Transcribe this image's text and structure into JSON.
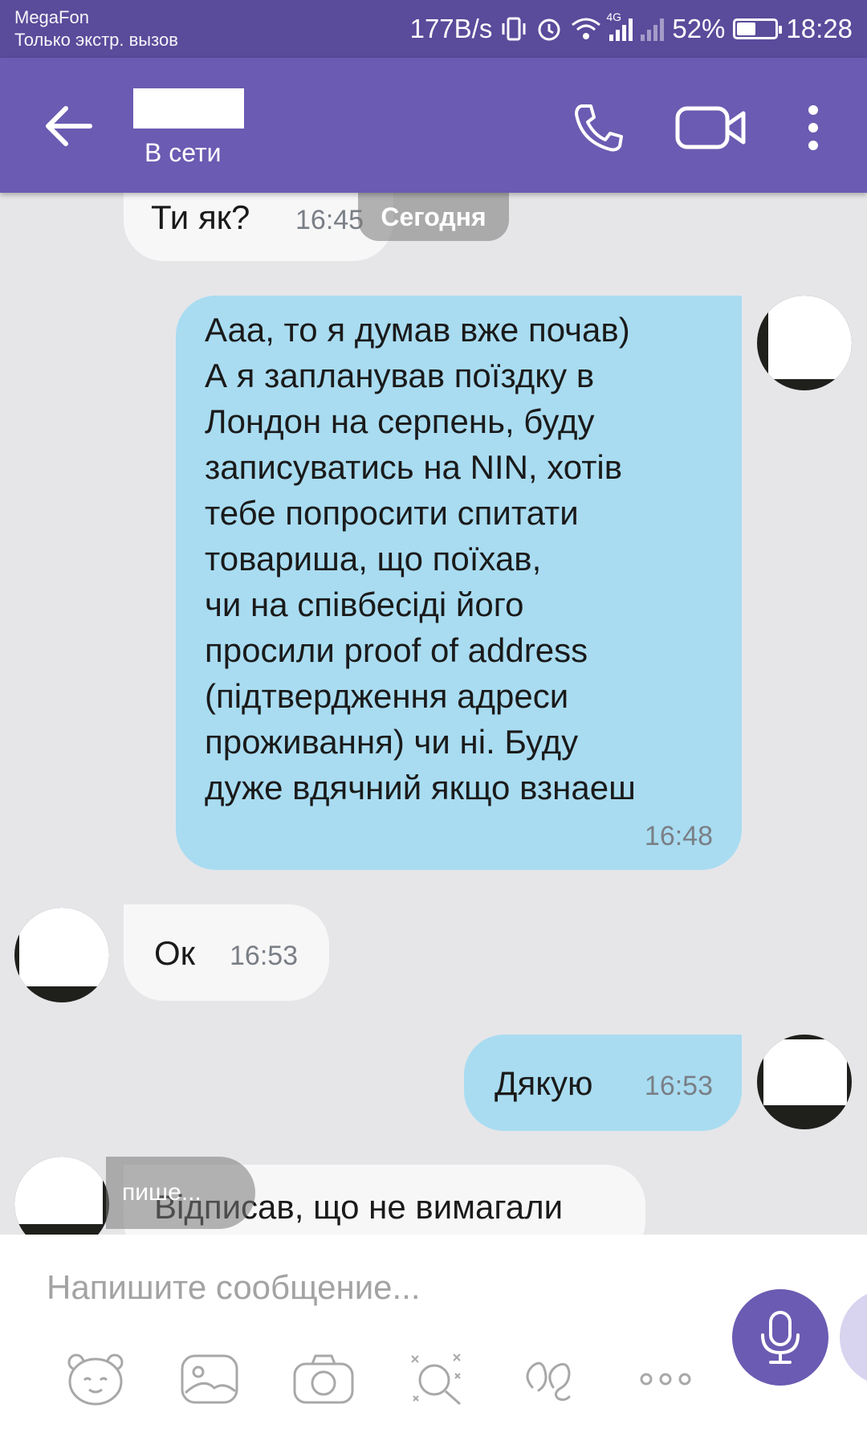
{
  "status_bar": {
    "carrier": "MegaFon",
    "carrier_note": "Только экстр. вызов",
    "net_speed": "177B/s",
    "network_type": "4G",
    "battery": "52%",
    "battery_level": 0.52,
    "time": "18:28"
  },
  "header": {
    "presence": "В сети",
    "icons": [
      "back-arrow-icon",
      "phone-icon",
      "video-camera-icon",
      "more-vertical-icon"
    ]
  },
  "chat": {
    "date_separator": "Сегодня",
    "messages": [
      {
        "direction": "in",
        "text": "Ти як?",
        "time": "16:45"
      },
      {
        "direction": "out",
        "lines": [
          "Ааа, то я думав вже почав)",
          "А я запланував поїздку в",
          "Лондон на серпень, буду",
          "записуватись на NIN, хотів",
          "тебе попросити спитати",
          "товариша, що поїхав,",
          "чи на співбесіді його",
          "просили proof of address",
          "(підтвердження адреси",
          "проживання) чи ні. Буду",
          "дуже вдячний якщо взнаеш"
        ],
        "time": "16:48"
      },
      {
        "direction": "in",
        "text": "Ок",
        "time": "16:53"
      },
      {
        "direction": "out",
        "text": "Дякую",
        "time": "16:53"
      },
      {
        "direction": "in",
        "text": "Відписав, що не вимагали",
        "time": ""
      }
    ],
    "typing_indicator": "пише..."
  },
  "composer": {
    "placeholder": "Напишите сообщение...",
    "tools": [
      "sticker-icon",
      "gallery-icon",
      "camera-icon",
      "doodle-icon",
      "gif-icon",
      "more-horizontal-icon"
    ],
    "mic": "microphone-icon"
  },
  "colors": {
    "header": "#6b5bb2",
    "status_bar": "#5a4b9b",
    "outgoing_bubble": "#a9dcf1",
    "incoming_bubble": "#f7f7f8",
    "background": "#e6e6e9"
  }
}
